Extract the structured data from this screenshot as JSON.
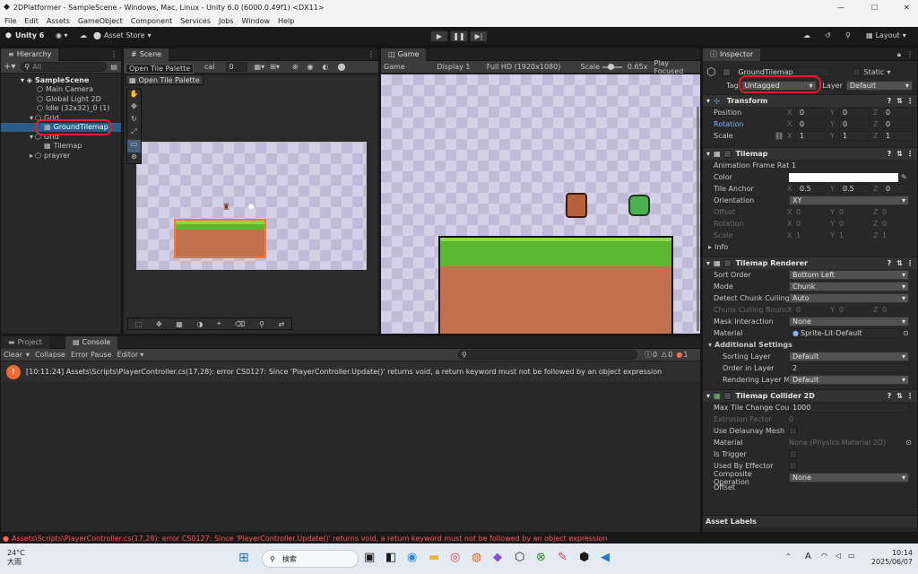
{
  "window": {
    "title": "2DPlatformer - SampleScene - Windows, Mac, Linux - Unity 6.0 (6000.0.49f1) <DX11>"
  },
  "menu": [
    "File",
    "Edit",
    "Assets",
    "GameObject",
    "Component",
    "Services",
    "Jobs",
    "Window",
    "Help"
  ],
  "toolbar": {
    "account": "Unity 6",
    "asset_store": "Asset Store",
    "layout": "Layout"
  },
  "hierarchy": {
    "tab": "Hierarchy",
    "search_placeholder": "All",
    "items": [
      {
        "label": "SampleScene"
      },
      {
        "label": "Main Camera"
      },
      {
        "label": "Global Light 2D"
      },
      {
        "label": "Idle (32x32)_0 (1)"
      },
      {
        "label": "Grid"
      },
      {
        "label": "GroundTilemap"
      },
      {
        "label": "Grid"
      },
      {
        "label": "Tilemap"
      },
      {
        "label": "prayrer"
      }
    ]
  },
  "scene": {
    "tab": "Scene",
    "palette_tooltip": "Open Tile Palette",
    "palette_button": "Open Tile Palette",
    "pivot_label": "cal",
    "grid_value": "0"
  },
  "game": {
    "tab": "Game",
    "mode": "Game",
    "display": "Display 1",
    "resolution": "Full HD (1920x1080)",
    "scale_label": "Scale",
    "scale_value": "0.65x",
    "play_focused": "Play Focused"
  },
  "bottom": {
    "tab_project": "Project",
    "tab_console": "Console",
    "clear": "Clear",
    "collapse": "Collapse",
    "error_pause": "Error Pause",
    "editor": "Editor",
    "count_log": "0",
    "count_warn": "0",
    "count_err": "1",
    "message": "[10:11:24] Assets\\Scripts\\PlayerController.cs(17,28): error CS0127: Since 'PlayerController.Update()' returns void, a return keyword must not be followed by an object expression"
  },
  "status_bar": "Assets\\Scripts\\PlayerController.cs(17,28): error CS0127: Since 'PlayerController.Update()' returns void, a return keyword must not be followed by an object expression",
  "inspector": {
    "tab": "Inspector",
    "object_name": "GroundTilemap",
    "static_label": "Static",
    "tag_label": "Tag",
    "tag_value": "Untagged",
    "layer_label": "Layer",
    "layer_value": "Default",
    "transform": {
      "title": "Transform",
      "position": {
        "label": "Position",
        "x": "0",
        "y": "0",
        "z": "0"
      },
      "rotation": {
        "label": "Rotation",
        "x": "0",
        "y": "0",
        "z": "0"
      },
      "scale": {
        "label": "Scale",
        "x": "1",
        "y": "1",
        "z": "1"
      }
    },
    "tilemap": {
      "title": "Tilemap",
      "anim_rate_label": "Animation Frame Rate",
      "anim_rate": "1",
      "color_label": "Color",
      "anchor_label": "Tile Anchor",
      "anchor": {
        "x": "0.5",
        "y": "0.5",
        "z": "0"
      },
      "orientation_label": "Orientation",
      "orientation": "XY",
      "offset_label": "Offset",
      "offset": {
        "x": "0",
        "y": "0",
        "z": "0"
      },
      "rotation_label": "Rotation",
      "rotation": {
        "x": "0",
        "y": "0",
        "z": "0"
      },
      "scale_label": "Scale",
      "scale": {
        "x": "1",
        "y": "1",
        "z": "1"
      },
      "info": "Info"
    },
    "renderer": {
      "title": "Tilemap Renderer",
      "sort_order_label": "Sort Order",
      "sort_order": "Bottom Left",
      "mode_label": "Mode",
      "mode": "Chunk",
      "detect_label": "Detect Chunk Culling",
      "detect": "Auto",
      "chunk_bounds_label": "Chunk Culling Bounds",
      "chunk_bounds": {
        "x": "0",
        "y": "0",
        "z": "0"
      },
      "mask_label": "Mask Interaction",
      "mask": "None",
      "material_label": "Material",
      "material": "Sprite-Lit-Default",
      "additional": "Additional Settings",
      "sorting_layer_label": "Sorting Layer",
      "sorting_layer": "Default",
      "order_label": "Order in Layer",
      "order": "2",
      "rendering_layer_label": "Rendering Layer M",
      "rendering_layer": "Default"
    },
    "collider": {
      "title": "Tilemap Collider 2D",
      "max_tile_label": "Max Tile Change Cou",
      "max_tile": "1000",
      "extrusion_label": "Extrusion Factor",
      "extrusion": "0",
      "delaunay_label": "Use Delaunay Mesh",
      "material_label": "Material",
      "material": "None (Physics Material 2D)",
      "trigger_label": "Is Trigger",
      "effector_label": "Used By Effector",
      "composite_label": "Composite Operation",
      "composite": "None",
      "offset_label": "Offset"
    },
    "asset_labels": "Asset Labels"
  },
  "taskbar": {
    "temp": "24°C",
    "weather": "大雨",
    "search": "検索",
    "time": "10:14",
    "date": "2025/06/07",
    "ime": "A"
  },
  "colors": {
    "accent_red": "#e0202c",
    "selection": "#2c5d87",
    "grass": "#5cb82e",
    "dirt": "#c2714c"
  }
}
